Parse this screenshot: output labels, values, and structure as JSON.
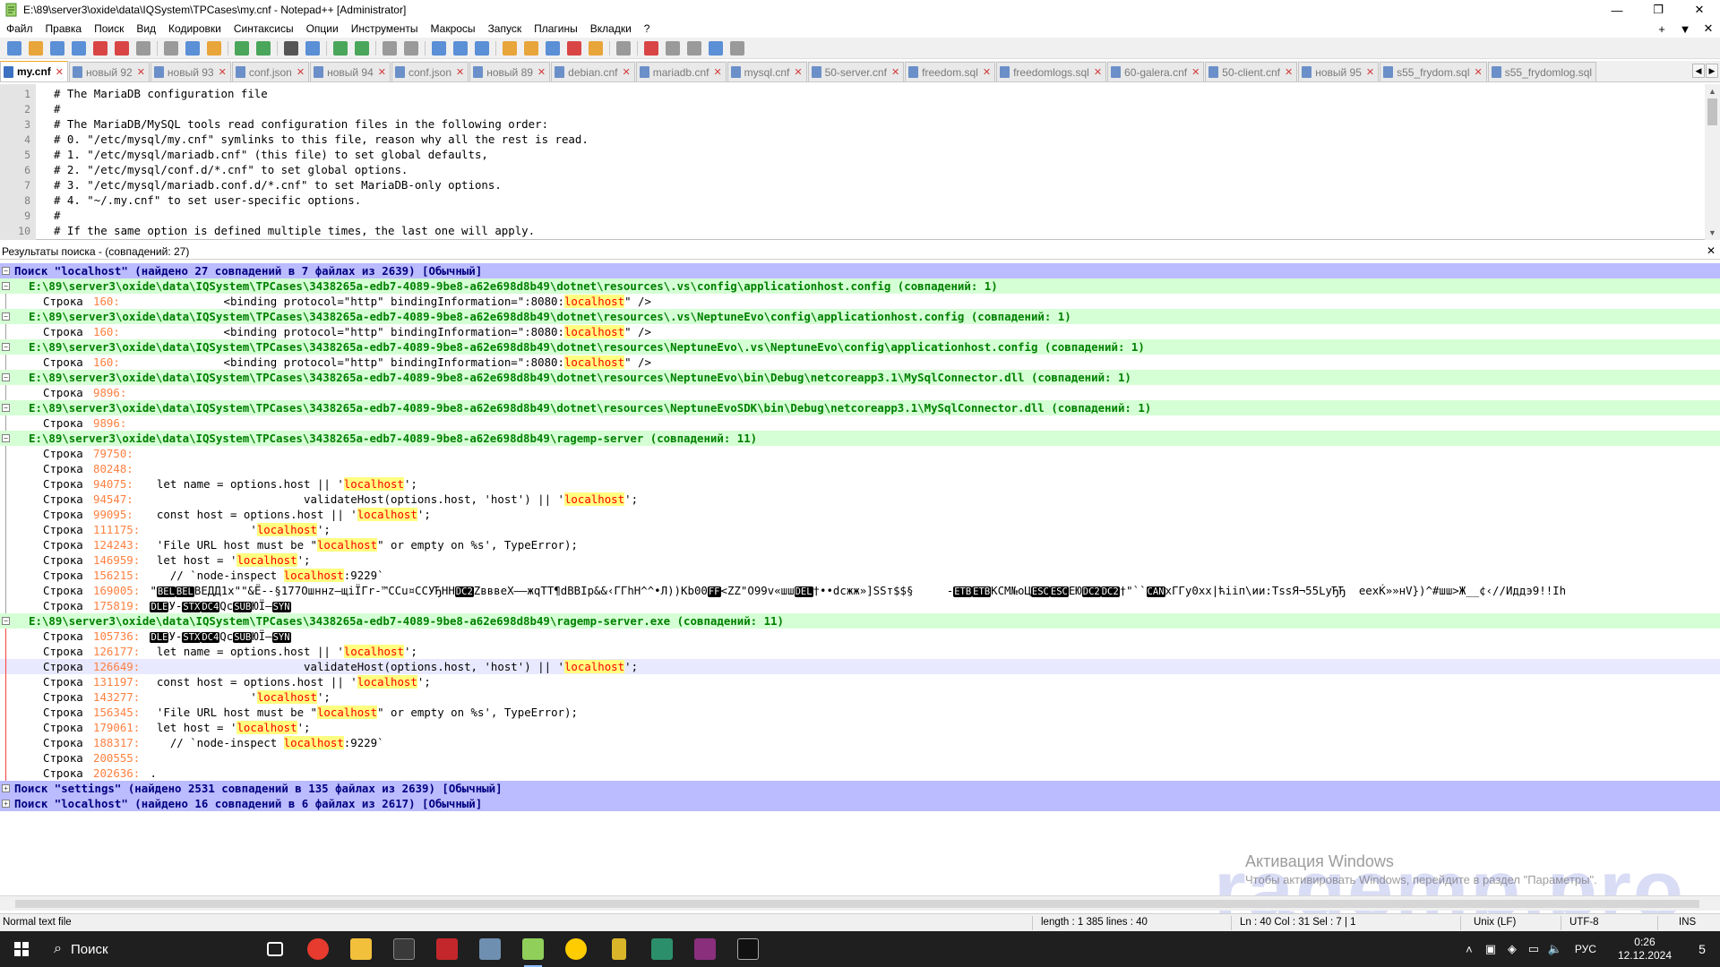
{
  "window": {
    "title": "E:\\89\\server3\\oxide\\data\\IQSystem\\TPCases\\my.cnf - Notepad++ [Administrator]",
    "controls": {
      "minimize": "—",
      "maximize": "❐",
      "close": "✕"
    }
  },
  "menu": {
    "items": [
      "Файл",
      "Правка",
      "Поиск",
      "Вид",
      "Кодировки",
      "Синтаксисы",
      "Опции",
      "Инструменты",
      "Макросы",
      "Запуск",
      "Плагины",
      "Вкладки",
      "?"
    ],
    "right": [
      "+",
      "▼",
      "✕"
    ]
  },
  "tabs": [
    {
      "label": "my.cnf",
      "active": true
    },
    {
      "label": "новый 92"
    },
    {
      "label": "новый 93"
    },
    {
      "label": "conf.json"
    },
    {
      "label": "новый 94"
    },
    {
      "label": "conf.json"
    },
    {
      "label": "новый 89"
    },
    {
      "label": "debian.cnf"
    },
    {
      "label": "mariadb.cnf"
    },
    {
      "label": "mysql.cnf"
    },
    {
      "label": "50-server.cnf"
    },
    {
      "label": "freedom.sql"
    },
    {
      "label": "freedomlogs.sql"
    },
    {
      "label": "60-galera.cnf"
    },
    {
      "label": "50-client.cnf"
    },
    {
      "label": "новый 95"
    },
    {
      "label": "s55_frydom.sql"
    },
    {
      "label": "s55_frydomlog.sql"
    }
  ],
  "editor": {
    "lines": [
      {
        "n": "1",
        "text": "# The MariaDB configuration file"
      },
      {
        "n": "2",
        "text": "#"
      },
      {
        "n": "3",
        "text": "# The MariaDB/MySQL tools read configuration files in the following order:"
      },
      {
        "n": "4",
        "text": "# 0. \"/etc/mysql/my.cnf\" symlinks to this file, reason why all the rest is read."
      },
      {
        "n": "5",
        "text": "# 1. \"/etc/mysql/mariadb.cnf\" (this file) to set global defaults,"
      },
      {
        "n": "6",
        "text": "# 2. \"/etc/mysql/conf.d/*.cnf\" to set global options."
      },
      {
        "n": "7",
        "text": "# 3. \"/etc/mysql/mariadb.conf.d/*.cnf\" to set MariaDB-only options."
      },
      {
        "n": "8",
        "text": "# 4. \"~/.my.cnf\" to set user-specific options."
      },
      {
        "n": "9",
        "text": "#"
      },
      {
        "n": "10",
        "text": "# If the same option is defined multiple times, the last one will apply."
      }
    ]
  },
  "results": {
    "header": "Результаты поиска - (совпадений: 27)",
    "close": "✕",
    "lines": [
      {
        "kind": "search",
        "fold": "−",
        "text": "Поиск \"localhost\" (найдено 27 совпадений в 7 файлах из 2639) [Обычный]"
      },
      {
        "kind": "file",
        "fold": "−",
        "text": "E:\\89\\server3\\oxide\\data\\IQSystem\\TPCases\\3438265a-edb7-4089-9be8-a62e698d8b49\\dotnet\\resources\\.vs\\config\\applicationhost.config (совпадений: 1)"
      },
      {
        "kind": "hit",
        "lbl": "Строка",
        "num": "160:",
        "pre": "            <binding protocol=\"http\" bindingInformation=\":8080:",
        "hl": "localhost",
        "post": "\" />"
      },
      {
        "kind": "file",
        "fold": "−",
        "text": "E:\\89\\server3\\oxide\\data\\IQSystem\\TPCases\\3438265a-edb7-4089-9be8-a62e698d8b49\\dotnet\\resources\\.vs\\NeptuneEvo\\config\\applicationhost.config (совпадений: 1)"
      },
      {
        "kind": "hit",
        "lbl": "Строка",
        "num": "160:",
        "pre": "            <binding protocol=\"http\" bindingInformation=\":8080:",
        "hl": "localhost",
        "post": "\" />"
      },
      {
        "kind": "file",
        "fold": "−",
        "text": "E:\\89\\server3\\oxide\\data\\IQSystem\\TPCases\\3438265a-edb7-4089-9be8-a62e698d8b49\\dotnet\\resources\\NeptuneEvo\\.vs\\NeptuneEvo\\config\\applicationhost.config (совпадений: 1)"
      },
      {
        "kind": "hit",
        "lbl": "Строка",
        "num": "160:",
        "pre": "            <binding protocol=\"http\" bindingInformation=\":8080:",
        "hl": "localhost",
        "post": "\" />"
      },
      {
        "kind": "file",
        "fold": "−",
        "text": "E:\\89\\server3\\oxide\\data\\IQSystem\\TPCases\\3438265a-edb7-4089-9be8-a62e698d8b49\\dotnet\\resources\\NeptuneEvo\\bin\\Debug\\netcoreapp3.1\\MySqlConnector.dll (совпадений: 1)"
      },
      {
        "kind": "hit",
        "lbl": "Строка",
        "num": "9896:",
        "pre": "",
        "hl": "",
        "post": ""
      },
      {
        "kind": "file",
        "fold": "−",
        "text": "E:\\89\\server3\\oxide\\data\\IQSystem\\TPCases\\3438265a-edb7-4089-9be8-a62e698d8b49\\dotnet\\resources\\NeptuneEvoSDK\\bin\\Debug\\netcoreapp3.1\\MySqlConnector.dll (совпадений: 1)"
      },
      {
        "kind": "hit",
        "lbl": "Строка",
        "num": "9896:",
        "pre": "",
        "hl": "",
        "post": ""
      },
      {
        "kind": "file",
        "fold": "−",
        "text": "E:\\89\\server3\\oxide\\data\\IQSystem\\TPCases\\3438265a-edb7-4089-9be8-a62e698d8b49\\ragemp-server (совпадений: 11)"
      },
      {
        "kind": "hit",
        "lbl": "Строка",
        "num": "79750:",
        "pre": "",
        "hl": "",
        "post": ""
      },
      {
        "kind": "hit",
        "lbl": "Строка",
        "num": "80248:",
        "pre": "",
        "hl": "",
        "post": ""
      },
      {
        "kind": "hit",
        "lbl": "Строка",
        "num": "94075:",
        "pre": "  let name = options.host || '",
        "hl": "localhost",
        "post": "';"
      },
      {
        "kind": "hit",
        "lbl": "Строка",
        "num": "94547:",
        "pre": "                        validateHost(options.host, 'host') || '",
        "hl": "localhost",
        "post": "';"
      },
      {
        "kind": "hit",
        "lbl": "Строка",
        "num": "99095:",
        "pre": "  const host = options.host || '",
        "hl": "localhost",
        "post": "';"
      },
      {
        "kind": "hit",
        "lbl": "Строка",
        "num": "111175:",
        "pre": "                '",
        "hl": "localhost",
        "post": "';"
      },
      {
        "kind": "hit",
        "lbl": "Строка",
        "num": "124243:",
        "pre": "  'File URL host must be \"",
        "hl": "localhost",
        "post": "\" or empty on %s', TypeError);"
      },
      {
        "kind": "hit",
        "lbl": "Строка",
        "num": "146959:",
        "pre": "  let host = '",
        "hl": "localhost",
        "post": "';"
      },
      {
        "kind": "hit",
        "lbl": "Строка",
        "num": "156215:",
        "pre": "    // `node-inspect ",
        "hl": "localhost",
        "post": ":9229`"
      },
      {
        "kind": "bin",
        "lbl": "Строка",
        "num": "169005:",
        "text": " \"[BEL][BEL]ВЕДД1x\"\"&Ё--§177Ошннz–щiÏΓr-™ССu¤ССУЂНН[DC2]ZвввеХ—–жqТТ¶dBBIp&&‹ГГhН^^•Л))Кb00[FF]<ZZ\"О99v«шш[DEL]†••dсжж»]SSт$$§     -[ETB][ETB]КСМ№оЦ[ESC][ESC]ЕЮ[DC2][DC2]†\"``[CAN]хГГу0хх|ћiiп\\ии:ТssЯ¬55LyЂЂ  еeхЌ»»нV})^#шш>Ж__¢‹//Иддэ9!!Іh"
      },
      {
        "kind": "bin",
        "lbl": "Строка",
        "num": "175819:",
        "text": " [DLE]У-[STX][DC4]Qс[SUB]ЮЇ–[SYN]"
      },
      {
        "kind": "file",
        "fold": "−",
        "red": true,
        "text": "E:\\89\\server3\\oxide\\data\\IQSystem\\TPCases\\3438265a-edb7-4089-9be8-a62e698d8b49\\ragemp-server.exe (совпадений: 11)"
      },
      {
        "kind": "bin",
        "lbl": "Строка",
        "num": "105736:",
        "red": true,
        "text": " [DLE]У-[STX][DC4]Qс[SUB]ЮЇ–[SYN]"
      },
      {
        "kind": "hit",
        "lbl": "Строка",
        "num": "126177:",
        "red": true,
        "pre": "  let name = options.host || '",
        "hl": "localhost",
        "post": "';"
      },
      {
        "kind": "hit",
        "lbl": "Строка",
        "num": "126649:",
        "red": true,
        "current": true,
        "pre": "                        validateHost(options.host, 'host') || '",
        "hl": "localhost",
        "post": "';"
      },
      {
        "kind": "hit",
        "lbl": "Строка",
        "num": "131197:",
        "red": true,
        "pre": "  const host = options.host || '",
        "hl": "localhost",
        "post": "';"
      },
      {
        "kind": "hit",
        "lbl": "Строка",
        "num": "143277:",
        "red": true,
        "pre": "                '",
        "hl": "localhost",
        "post": "';"
      },
      {
        "kind": "hit",
        "lbl": "Строка",
        "num": "156345:",
        "red": true,
        "pre": "  'File URL host must be \"",
        "hl": "localhost",
        "post": "\" or empty on %s', TypeError);"
      },
      {
        "kind": "hit",
        "lbl": "Строка",
        "num": "179061:",
        "red": true,
        "pre": "  let host = '",
        "hl": "localhost",
        "post": "';"
      },
      {
        "kind": "hit",
        "lbl": "Строка",
        "num": "188317:",
        "red": true,
        "pre": "    // `node-inspect ",
        "hl": "localhost",
        "post": ":9229`"
      },
      {
        "kind": "hit",
        "lbl": "Строка",
        "num": "200555:",
        "red": true,
        "pre": "",
        "hl": "",
        "post": ""
      },
      {
        "kind": "hit",
        "lbl": "Строка",
        "num": "202636:",
        "red": true,
        "pre": " .",
        "hl": "",
        "post": ""
      },
      {
        "kind": "search",
        "fold": "+",
        "text": "Поиск \"settings\" (найдено 2531 совпадений в 135 файлах из 2639) [Обычный]"
      },
      {
        "kind": "search",
        "fold": "+",
        "text": "Поиск \"localhost\" (найдено 16 совпадений в 6 файлах из 2617) [Обычный]"
      }
    ]
  },
  "watermark": {
    "activation_title": "Активация Windows",
    "activation_text": "Чтобы активировать Windows, перейдите в раздел \"Параметры\".",
    "site": "ragemp.pro"
  },
  "status": {
    "type": "Normal text file",
    "length": "length : 1 385    lines : 40",
    "position": "Ln : 40    Col : 31    Sel : 7 | 1",
    "eol": "Unix (LF)",
    "encoding": "UTF-8",
    "mode": "INS"
  },
  "taskbar": {
    "search_placeholder": "Поиск",
    "lang": "РУС",
    "time": "0:26",
    "date": "12.12.2024",
    "notifications": "5"
  },
  "colors": {
    "search_line_bg": "#bbbbff",
    "file_line_bg": "#d5ffd5",
    "match_fg": "#ff0000",
    "match_bg": "#ffff80",
    "active_tab_accent": "#f6a623"
  }
}
